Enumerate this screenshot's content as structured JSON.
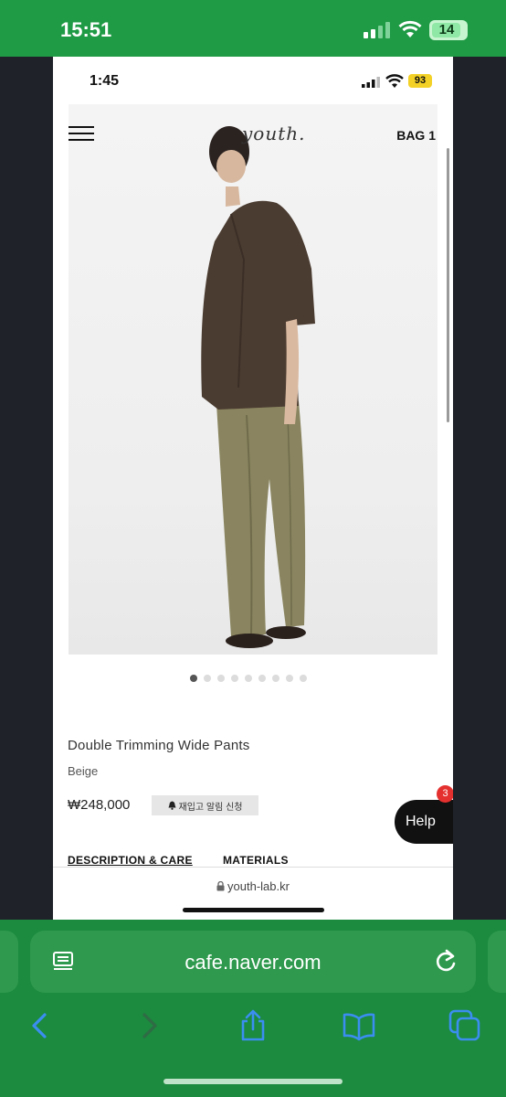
{
  "outer_status": {
    "time": "15:51",
    "battery": "14"
  },
  "inner_status": {
    "time": "1:45",
    "battery": "93"
  },
  "site": {
    "logo": "youth.",
    "bag_label": "BAG 1"
  },
  "carousel": {
    "count": 9,
    "active_index": 0
  },
  "product": {
    "name": "Double Trimming Wide Pants",
    "color": "Beige",
    "price": "₩248,000",
    "restock_button": "재입고 알림 신청"
  },
  "help": {
    "label": "Help",
    "badge": "3"
  },
  "tabs": [
    {
      "label": "DESCRIPTION & CARE",
      "active": true
    },
    {
      "label": "MATERIALS",
      "active": false
    }
  ],
  "inner_url": "youth-lab.kr",
  "browser": {
    "url": "cafe.naver.com"
  },
  "colors": {
    "chrome_green": "#1c8a3f",
    "status_green": "#1f9a45",
    "badge_red": "#e4312f",
    "battery_yellow": "#f3d126"
  },
  "icons": [
    "menu-icon",
    "lock-icon",
    "bell-icon",
    "reader-mode-icon",
    "reload-icon",
    "back-icon",
    "forward-icon",
    "share-icon",
    "bookmarks-icon",
    "tabs-icon"
  ]
}
